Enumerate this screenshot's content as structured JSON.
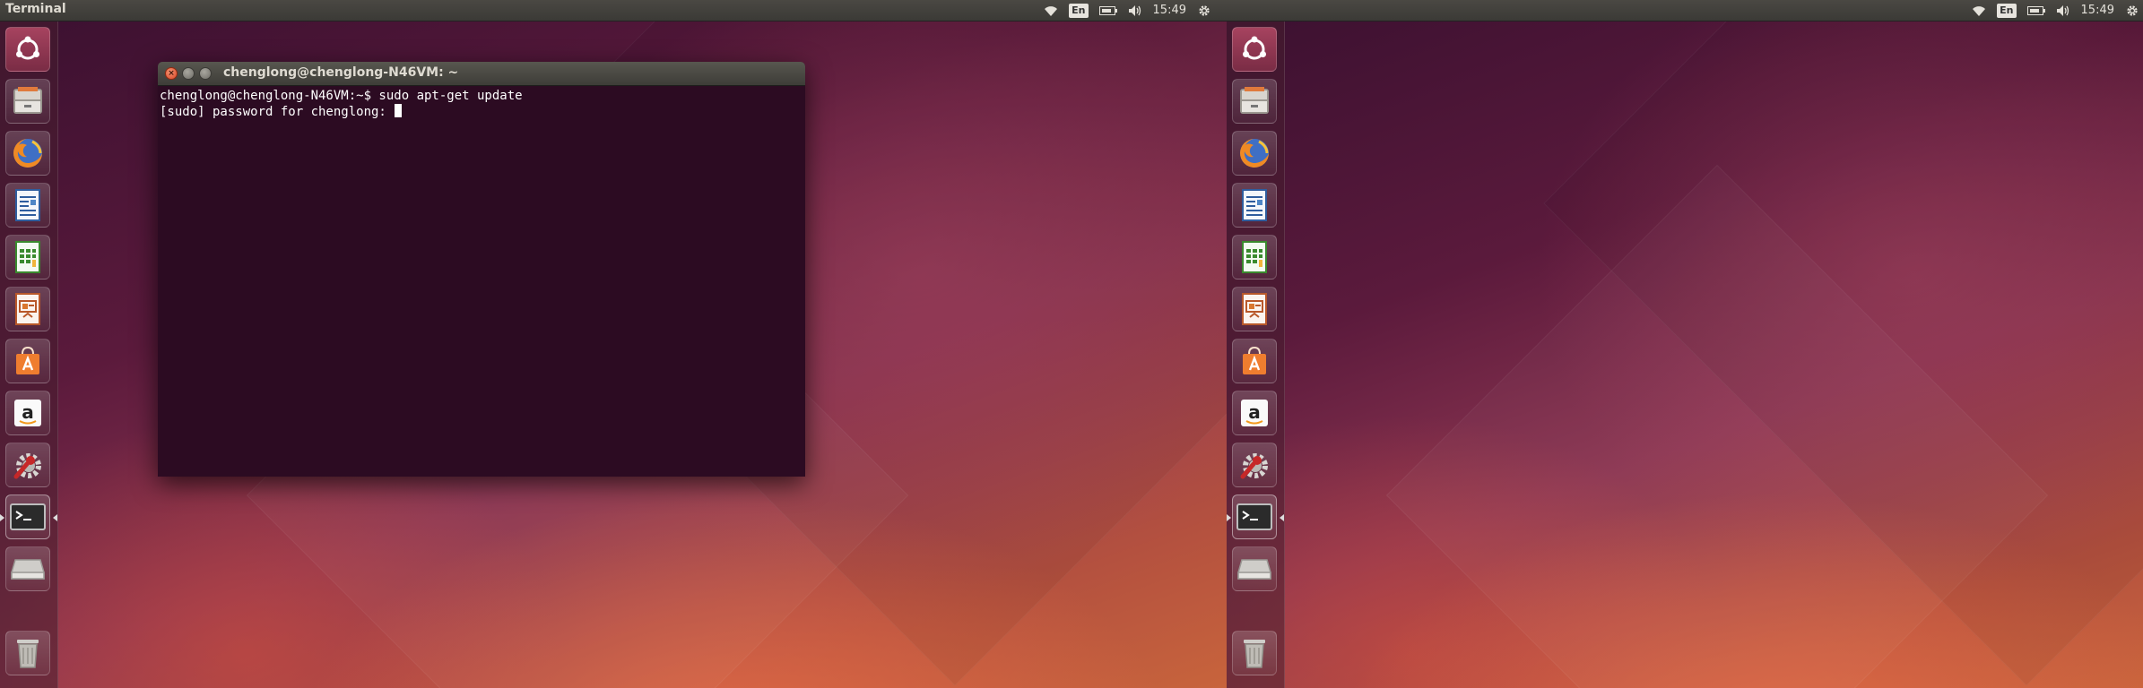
{
  "panel": {
    "app_title": "Terminal",
    "language": "En",
    "clock": "15:49"
  },
  "launcher": {
    "items": [
      {
        "name": "dash-home-button",
        "icon": "ubuntu-logo-icon"
      },
      {
        "name": "files-button",
        "icon": "file-cabinet-icon"
      },
      {
        "name": "firefox-button",
        "icon": "firefox-icon"
      },
      {
        "name": "libreoffice-writer-button",
        "icon": "writer-document-icon"
      },
      {
        "name": "libreoffice-calc-button",
        "icon": "calc-spreadsheet-icon"
      },
      {
        "name": "libreoffice-impress-button",
        "icon": "impress-presentation-icon"
      },
      {
        "name": "ubuntu-software-center-button",
        "icon": "software-center-bag-icon"
      },
      {
        "name": "amazon-button",
        "icon": "amazon-icon"
      },
      {
        "name": "system-settings-button",
        "icon": "settings-wrench-icon"
      },
      {
        "name": "terminal-button",
        "icon": "terminal-icon",
        "active": true
      },
      {
        "name": "drive-button",
        "icon": "hard-drive-icon"
      },
      {
        "name": "trash-button",
        "icon": "trash-icon"
      }
    ]
  },
  "terminal": {
    "title": "chenglong@chenglong-N46VM: ~",
    "lines": [
      "chenglong@chenglong-N46VM:~$ sudo apt-get update",
      "[sudo] password for chenglong: "
    ]
  },
  "colors": {
    "panel": "#3b3a36",
    "terminal_bg": "#2c0b22",
    "close_button": "#d9482a",
    "wallpaper_accent": "#c8643c"
  }
}
